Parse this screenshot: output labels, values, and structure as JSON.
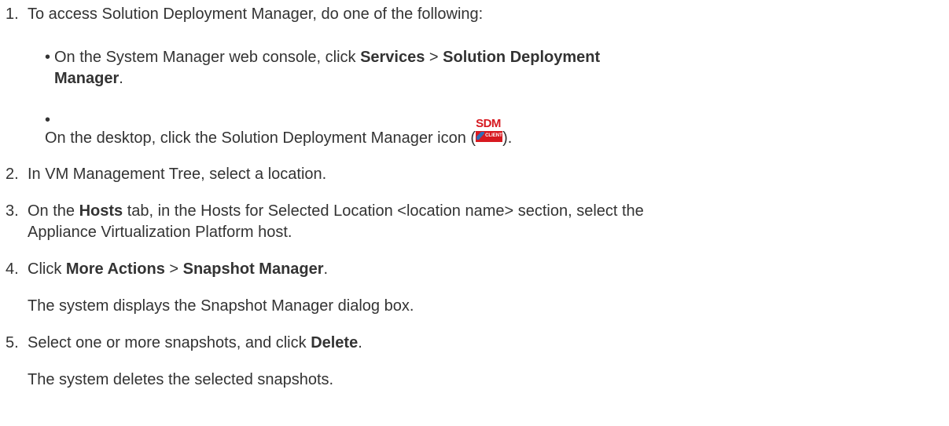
{
  "steps": [
    {
      "num": "1.",
      "text": "To access Solution Deployment Manager, do one of the following:"
    },
    {
      "num": "2.",
      "text": "In VM Management Tree, select a location."
    },
    {
      "num": "3.",
      "pre": "On the ",
      "bold": "Hosts",
      "post_line1": " tab, in the Hosts for Selected Location <location name> section, select the",
      "post_line2": "Appliance Virtualization Platform host."
    },
    {
      "num": "4.",
      "pre": "Click ",
      "bold1": "More Actions",
      "sep": " > ",
      "bold2": "Snapshot Manager",
      "end": ".",
      "result": "The system displays the Snapshot Manager dialog box."
    },
    {
      "num": "5.",
      "pre": "Select one or more snapshots, and click ",
      "bold": "Delete",
      "end": ".",
      "result": "The system deletes the selected snapshots."
    }
  ],
  "substeps": [
    {
      "bullet": "•",
      "pre": "On the System Manager web console, click ",
      "bold1": "Services",
      "sep": " > ",
      "bold2": "Solution Deployment",
      "bold3": "Manager",
      "end": "."
    },
    {
      "bullet": "•",
      "pre": "On the desktop, click the Solution Deployment Manager icon (",
      "end": ")."
    }
  ],
  "icon": {
    "name": "sdm-client-icon",
    "label": "SDM",
    "sublabel": "CLIENT",
    "color": "#d71920"
  },
  "colors": {
    "text": "#333333",
    "background": "#ffffff"
  }
}
